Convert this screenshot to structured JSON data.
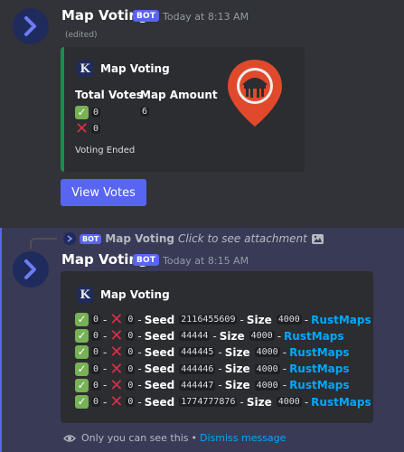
{
  "message1": {
    "username": "Map Voting",
    "bot_tag": "BOT",
    "timestamp": "Today at 8:13 AM",
    "edited": "(edited)",
    "embed": {
      "author": "Map Voting",
      "field1_name": "Total Votes",
      "field2_name": "Map Amount",
      "yes_count": "0",
      "no_count": "0",
      "map_amount": "6",
      "footer": "Voting Ended",
      "accent_color": "#1f8b4c"
    },
    "button_label": "View Votes"
  },
  "message2": {
    "reply": {
      "bot_tag": "BOT",
      "name": "Map Voting",
      "text": "Click to see attachment"
    },
    "username": "Map Voting",
    "bot_tag": "BOT",
    "timestamp": "Today at 8:15 AM",
    "embed": {
      "author": "Map Voting",
      "sep": "-",
      "seed_label": "Seed",
      "size_label": "Size",
      "rows": [
        {
          "yes": "0",
          "no": "0",
          "seed": "2116455609",
          "size": "4000",
          "link": "RustMaps"
        },
        {
          "yes": "0",
          "no": "0",
          "seed": "44444",
          "size": "4000",
          "link": "RustMaps"
        },
        {
          "yes": "0",
          "no": "0",
          "seed": "444445",
          "size": "4000",
          "link": "RustMaps"
        },
        {
          "yes": "0",
          "no": "0",
          "seed": "444446",
          "size": "4000",
          "link": "RustMaps"
        },
        {
          "yes": "0",
          "no": "0",
          "seed": "444447",
          "size": "4000",
          "link": "RustMaps"
        },
        {
          "yes": "0",
          "no": "0",
          "seed": "1774777876",
          "size": "4000",
          "link": "RustMaps"
        }
      ]
    },
    "ephemeral_text": "Only you can see this",
    "ephemeral_dot": "•",
    "dismiss_label": "Dismiss message"
  },
  "colors": {
    "background": "#313338",
    "blurple": "#5865f2",
    "link": "#00a8fc",
    "check": "#77b255",
    "cross": "#dd2e44"
  }
}
